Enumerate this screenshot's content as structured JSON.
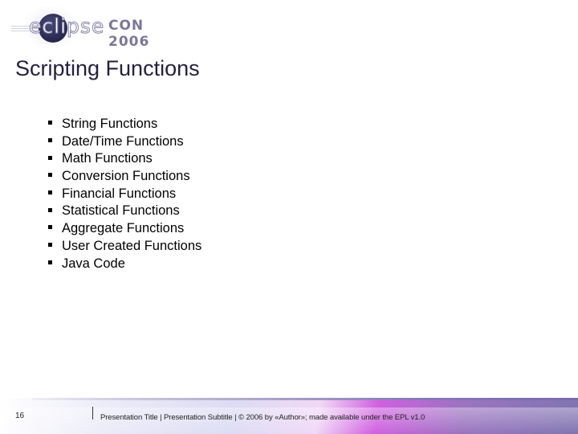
{
  "logo": {
    "brand_light": "eclipse",
    "brand_bold": "CON 2006"
  },
  "slide": {
    "title": "Scripting Functions",
    "bullets": [
      "String Functions",
      "Date/Time Functions",
      "Math Functions",
      "Conversion Functions",
      "Financial Functions",
      "Statistical Functions",
      "Aggregate Functions",
      "User Created Functions",
      "Java Code"
    ]
  },
  "footer": {
    "page_number": "16",
    "text": "Presentation Title | Presentation Subtitle | © 2006 by «Author»; made available under the EPL v1.0"
  },
  "colors": {
    "title": "#262040",
    "logo_accent": "#7d7699",
    "footer_purple": "#d060e0"
  }
}
